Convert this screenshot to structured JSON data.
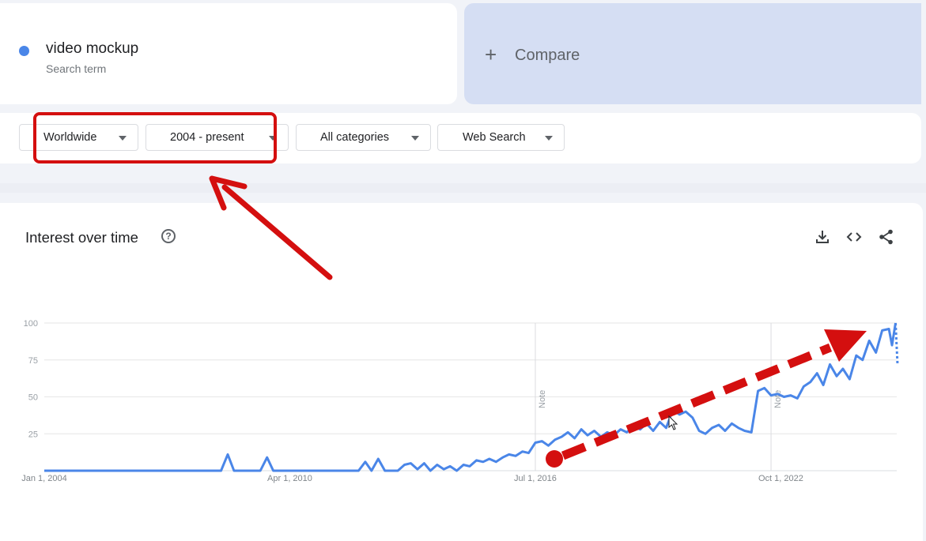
{
  "search_term": {
    "name": "video mockup",
    "label": "Search term",
    "color": "#4a86e8"
  },
  "compare": {
    "plus": "+",
    "label": "Compare"
  },
  "filters": {
    "region": "Worldwide",
    "time_range": "2004 - present",
    "category": "All categories",
    "property": "Web Search"
  },
  "chart": {
    "title": "Interest over time",
    "help_icon": "?",
    "toolbar_icons": [
      "download-icon",
      "embed-code-icon",
      "share-icon"
    ]
  },
  "chart_data": {
    "type": "line",
    "title": "Interest over time",
    "xlabel": "",
    "ylabel": "",
    "x_tick_labels": [
      "Jan 1, 2004",
      "Apr 1, 2010",
      "Jul 1, 2016",
      "Oct 1, 2022"
    ],
    "x_tick_years": [
      2004.0,
      2010.25,
      2016.5,
      2022.75
    ],
    "y_ticks": [
      25,
      50,
      75,
      100
    ],
    "ylim": [
      0,
      100
    ],
    "xlim": [
      2004.0,
      2025.7
    ],
    "grid": true,
    "notes": [
      {
        "x": 2016.5,
        "label": "Note"
      },
      {
        "x": 2022.5,
        "label": "Note"
      }
    ],
    "series": [
      {
        "name": "video mockup",
        "color": "#4a86e8",
        "points": [
          [
            2004.0,
            0
          ],
          [
            2008.5,
            0
          ],
          [
            2008.67,
            11
          ],
          [
            2008.83,
            0
          ],
          [
            2009.5,
            0
          ],
          [
            2009.67,
            9
          ],
          [
            2009.83,
            0
          ],
          [
            2012.0,
            0
          ],
          [
            2012.17,
            6
          ],
          [
            2012.33,
            0
          ],
          [
            2012.5,
            8
          ],
          [
            2012.67,
            0
          ],
          [
            2013.0,
            0
          ],
          [
            2013.17,
            4
          ],
          [
            2013.33,
            5
          ],
          [
            2013.5,
            1
          ],
          [
            2013.67,
            5
          ],
          [
            2013.83,
            0
          ],
          [
            2014.0,
            4
          ],
          [
            2014.17,
            1
          ],
          [
            2014.33,
            3
          ],
          [
            2014.5,
            0
          ],
          [
            2014.67,
            4
          ],
          [
            2014.83,
            3
          ],
          [
            2015.0,
            7
          ],
          [
            2015.17,
            6
          ],
          [
            2015.33,
            8
          ],
          [
            2015.5,
            6
          ],
          [
            2015.67,
            9
          ],
          [
            2015.83,
            11
          ],
          [
            2016.0,
            10
          ],
          [
            2016.17,
            13
          ],
          [
            2016.33,
            12
          ],
          [
            2016.5,
            19
          ],
          [
            2016.67,
            20
          ],
          [
            2016.83,
            17
          ],
          [
            2017.0,
            21
          ],
          [
            2017.17,
            23
          ],
          [
            2017.33,
            26
          ],
          [
            2017.5,
            22
          ],
          [
            2017.67,
            28
          ],
          [
            2017.83,
            24
          ],
          [
            2018.0,
            27
          ],
          [
            2018.17,
            23
          ],
          [
            2018.33,
            26
          ],
          [
            2018.5,
            24
          ],
          [
            2018.67,
            28
          ],
          [
            2018.83,
            26
          ],
          [
            2019.0,
            30
          ],
          [
            2019.17,
            28
          ],
          [
            2019.33,
            32
          ],
          [
            2019.5,
            27
          ],
          [
            2019.67,
            33
          ],
          [
            2019.83,
            29
          ],
          [
            2020.0,
            41
          ],
          [
            2020.17,
            38
          ],
          [
            2020.33,
            40
          ],
          [
            2020.5,
            36
          ],
          [
            2020.67,
            27
          ],
          [
            2020.83,
            25
          ],
          [
            2021.0,
            29
          ],
          [
            2021.17,
            31
          ],
          [
            2021.33,
            27
          ],
          [
            2021.5,
            32
          ],
          [
            2021.67,
            29
          ],
          [
            2021.83,
            27
          ],
          [
            2022.0,
            26
          ],
          [
            2022.17,
            54
          ],
          [
            2022.33,
            56
          ],
          [
            2022.5,
            51
          ],
          [
            2022.67,
            52
          ],
          [
            2022.83,
            50
          ],
          [
            2023.0,
            51
          ],
          [
            2023.17,
            49
          ],
          [
            2023.33,
            57
          ],
          [
            2023.5,
            60
          ],
          [
            2023.67,
            66
          ],
          [
            2023.83,
            58
          ],
          [
            2024.0,
            72
          ],
          [
            2024.17,
            64
          ],
          [
            2024.33,
            69
          ],
          [
            2024.5,
            62
          ],
          [
            2024.67,
            78
          ],
          [
            2024.83,
            75
          ],
          [
            2025.0,
            88
          ],
          [
            2025.17,
            80
          ],
          [
            2025.33,
            95
          ],
          [
            2025.5,
            96
          ],
          [
            2025.58,
            85
          ],
          [
            2025.67,
            100
          ]
        ],
        "partial_points": [
          [
            2025.67,
            100
          ],
          [
            2025.72,
            72
          ]
        ]
      }
    ]
  }
}
